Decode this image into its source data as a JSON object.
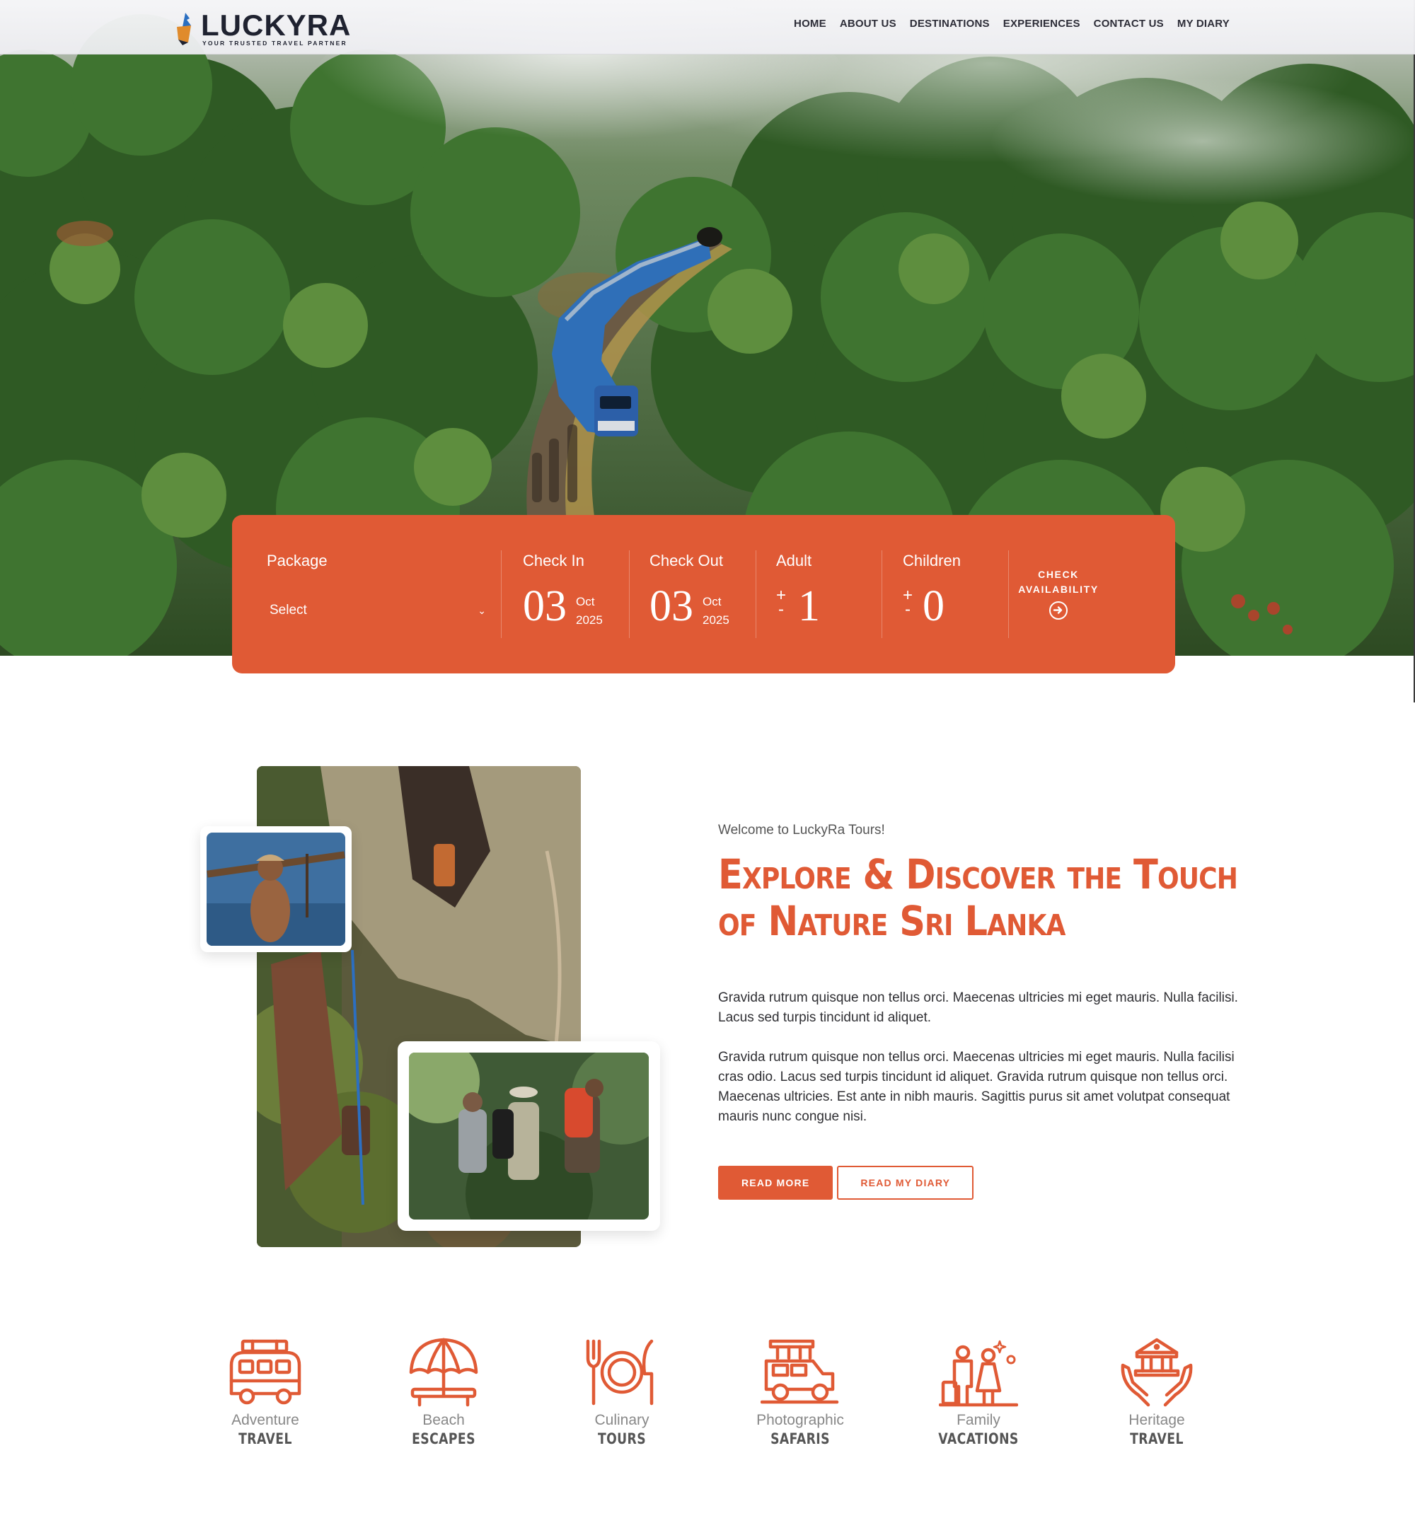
{
  "brand": {
    "name": "LUCKYRA",
    "tagline": "YOUR TRUSTED TRAVEL PARTNER",
    "accent_color": "#e05a35"
  },
  "nav": {
    "items": [
      {
        "label": "HOME"
      },
      {
        "label": "ABOUT US"
      },
      {
        "label": "DESTINATIONS"
      },
      {
        "label": "EXPERIENCES"
      },
      {
        "label": "CONTACT US"
      },
      {
        "label": "MY DIARY"
      }
    ]
  },
  "booking": {
    "package": {
      "label": "Package",
      "value": "Select"
    },
    "check_in": {
      "label": "Check In",
      "day": "03",
      "month": "Oct",
      "year": "2025"
    },
    "check_out": {
      "label": "Check Out",
      "day": "03",
      "month": "Oct",
      "year": "2025"
    },
    "adult": {
      "label": "Adult",
      "count": "1",
      "plus": "+",
      "minus": "-"
    },
    "children": {
      "label": "Children",
      "count": "0",
      "plus": "+",
      "minus": "-"
    },
    "cta": {
      "line1": "CHECK",
      "line2": "AVAILABILITY"
    }
  },
  "about": {
    "kicker": "Welcome to LuckyRa Tours!",
    "headline_line1": "Explore & Discover the Touch",
    "headline_line2": "of Nature Sri Lanka",
    "para1": "Gravida rutrum quisque non tellus orci. Maecenas ultricies mi eget mauris. Nulla facilisi. Lacus sed turpis tincidunt id aliquet.",
    "para2": "Gravida rutrum quisque non tellus orci. Maecenas ultricies mi eget mauris. Nulla facilisi cras odio. Lacus sed turpis tincidunt id aliquet. Gravida rutrum quisque non tellus orci. Maecenas ultricies. Est ante in nibh mauris. Sagittis purus sit amet volutpat consequat mauris nunc congue nisi.",
    "read_more": "READ MORE",
    "read_diary": "READ MY DIARY"
  },
  "categories": [
    {
      "top": "Adventure",
      "bottom": "TRAVEL",
      "icon": "van-icon"
    },
    {
      "top": "Beach",
      "bottom": "ESCAPES",
      "icon": "beach-umbrella-icon"
    },
    {
      "top": "Culinary",
      "bottom": "TOURS",
      "icon": "plate-cutlery-icon"
    },
    {
      "top": "Photographic",
      "bottom": "SAFARIS",
      "icon": "safari-jeep-icon"
    },
    {
      "top": "Family",
      "bottom": "VACATIONS",
      "icon": "family-icon"
    },
    {
      "top": "Heritage",
      "bottom": "TRAVEL",
      "icon": "heritage-hands-icon"
    }
  ]
}
